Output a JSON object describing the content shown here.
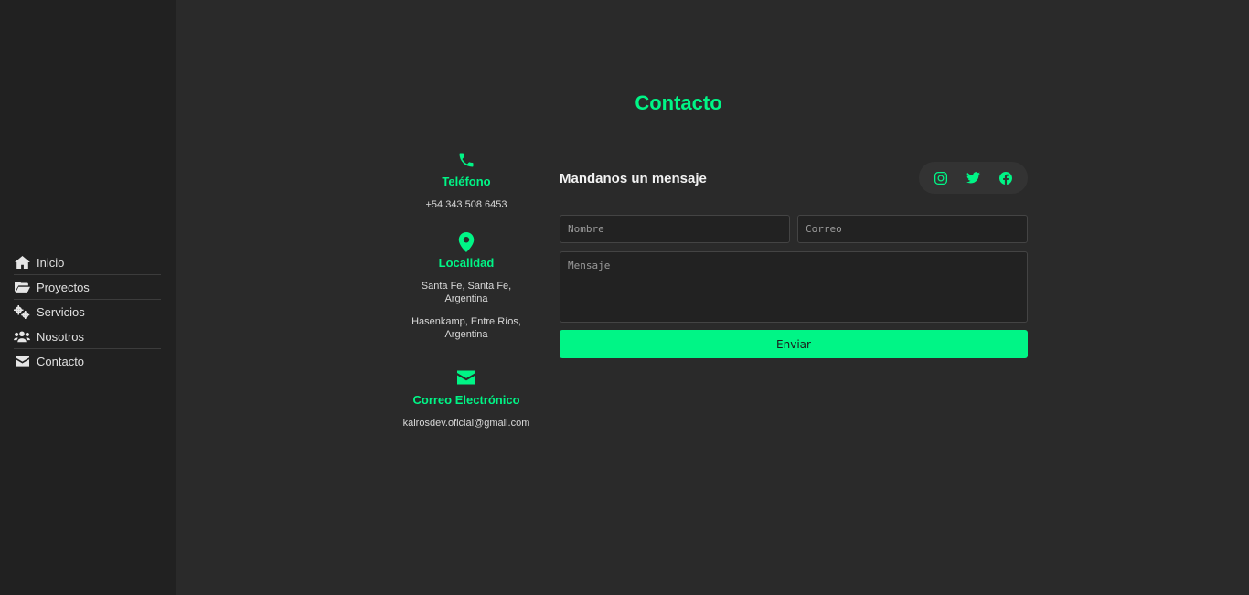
{
  "sidebar": {
    "items": [
      {
        "label": "Inicio",
        "icon": "home-icon"
      },
      {
        "label": "Proyectos",
        "icon": "folder-open-icon"
      },
      {
        "label": "Servicios",
        "icon": "gears-icon"
      },
      {
        "label": "Nosotros",
        "icon": "users-icon"
      },
      {
        "label": "Contacto",
        "icon": "envelope-icon"
      }
    ]
  },
  "page": {
    "title": "Contacto",
    "accent_color": "#00f586"
  },
  "contact_info": {
    "phone": {
      "label": "Teléfono",
      "value": "+54 343 508 6453",
      "icon": "phone-icon"
    },
    "location": {
      "label": "Localidad",
      "icon": "map-marker-icon",
      "lines": [
        "Santa Fe, Santa Fe,",
        "Argentina",
        "Hasenkamp, Entre Ríos,",
        "Argentina"
      ]
    },
    "email": {
      "label": "Correo Electrónico",
      "value": "kairosdev.oficial@gmail.com",
      "icon": "envelope-icon"
    }
  },
  "form": {
    "heading": "Mandanos un mensaje",
    "name_placeholder": "Nombre",
    "email_placeholder": "Correo",
    "message_placeholder": "Mensaje",
    "submit_label": "Enviar",
    "social": [
      "instagram-icon",
      "twitter-icon",
      "facebook-icon"
    ]
  }
}
